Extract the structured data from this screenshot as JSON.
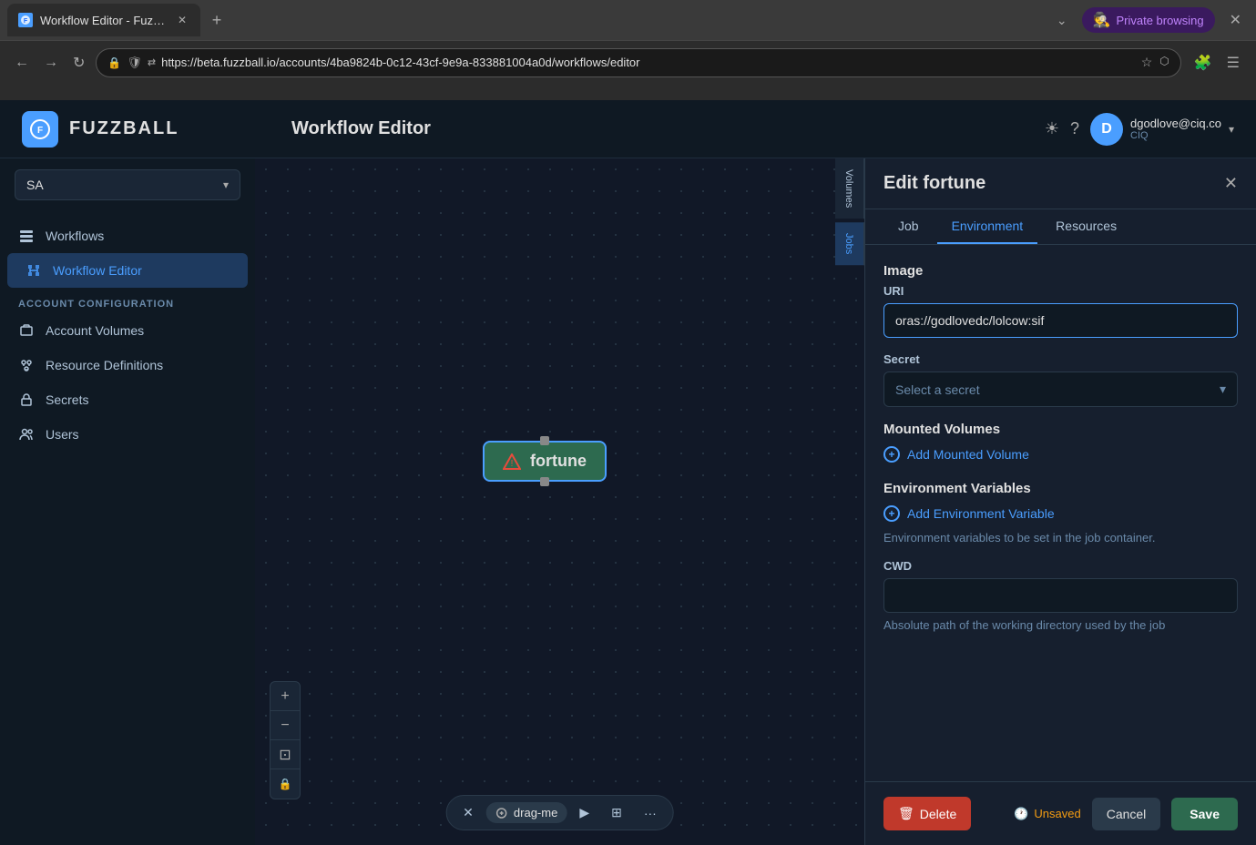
{
  "browser": {
    "tab_title": "Workflow Editor - Fuzzba...",
    "favicon_letter": "F",
    "url": "https://beta.fuzzball.io/accounts/4ba9824b-0c12-43cf-9e9a-833881004a0d/workflows/editor",
    "private_browsing_label": "Private browsing",
    "new_tab_icon": "+",
    "back_icon": "←",
    "forward_icon": "→",
    "reload_icon": "↻"
  },
  "sidebar": {
    "logo_letter": "F",
    "logo_text": "FUZZBALL",
    "org_name": "SA",
    "nav_items": [
      {
        "id": "workflows",
        "label": "Workflows",
        "active": false
      },
      {
        "id": "workflow-editor",
        "label": "Workflow Editor",
        "active": true
      }
    ],
    "section_label": "ACCOUNT CONFIGURATION",
    "account_items": [
      {
        "id": "account-volumes",
        "label": "Account Volumes"
      },
      {
        "id": "resource-definitions",
        "label": "Resource Definitions"
      },
      {
        "id": "secrets",
        "label": "Secrets"
      },
      {
        "id": "users",
        "label": "Users"
      }
    ]
  },
  "header": {
    "title": "Workflow Editor"
  },
  "user": {
    "avatar_letter": "D",
    "email": "dgodlove@ciq.co",
    "org": "CIQ"
  },
  "canvas": {
    "volumes_tab": "Volumes",
    "jobs_tab": "Jobs",
    "node_label": "fortune",
    "controls": {
      "zoom_in": "+",
      "zoom_out": "−",
      "fit": "⊡",
      "lock": "🔒"
    },
    "toolbar": {
      "close_icon": "✕",
      "drag_me_label": "drag-me",
      "play_icon": "▶",
      "grid_icon": "⊞",
      "more_icon": "···"
    }
  },
  "panel": {
    "title": "Edit fortune",
    "tabs": [
      {
        "id": "job",
        "label": "Job",
        "active": false
      },
      {
        "id": "environment",
        "label": "Environment",
        "active": true
      },
      {
        "id": "resources",
        "label": "Resources",
        "active": false
      }
    ],
    "sections": {
      "image": {
        "label": "Image",
        "uri_label": "URI",
        "uri_value": "oras://godlovedc/lolcow:sif",
        "uri_placeholder": ""
      },
      "secret": {
        "label": "Secret",
        "select_placeholder": "Select a secret"
      },
      "mounted_volumes": {
        "label": "Mounted Volumes",
        "add_label": "Add Mounted Volume"
      },
      "environment_variables": {
        "label": "Environment Variables",
        "add_label": "Add Environment Variable",
        "desc": "Environment variables to be set in the job container."
      },
      "cwd": {
        "label": "CWD",
        "desc": "Absolute path of the working directory used by the job",
        "value": ""
      }
    },
    "footer": {
      "delete_label": "Delete",
      "unsaved_label": "Unsaved",
      "cancel_label": "Cancel",
      "save_label": "Save"
    }
  }
}
